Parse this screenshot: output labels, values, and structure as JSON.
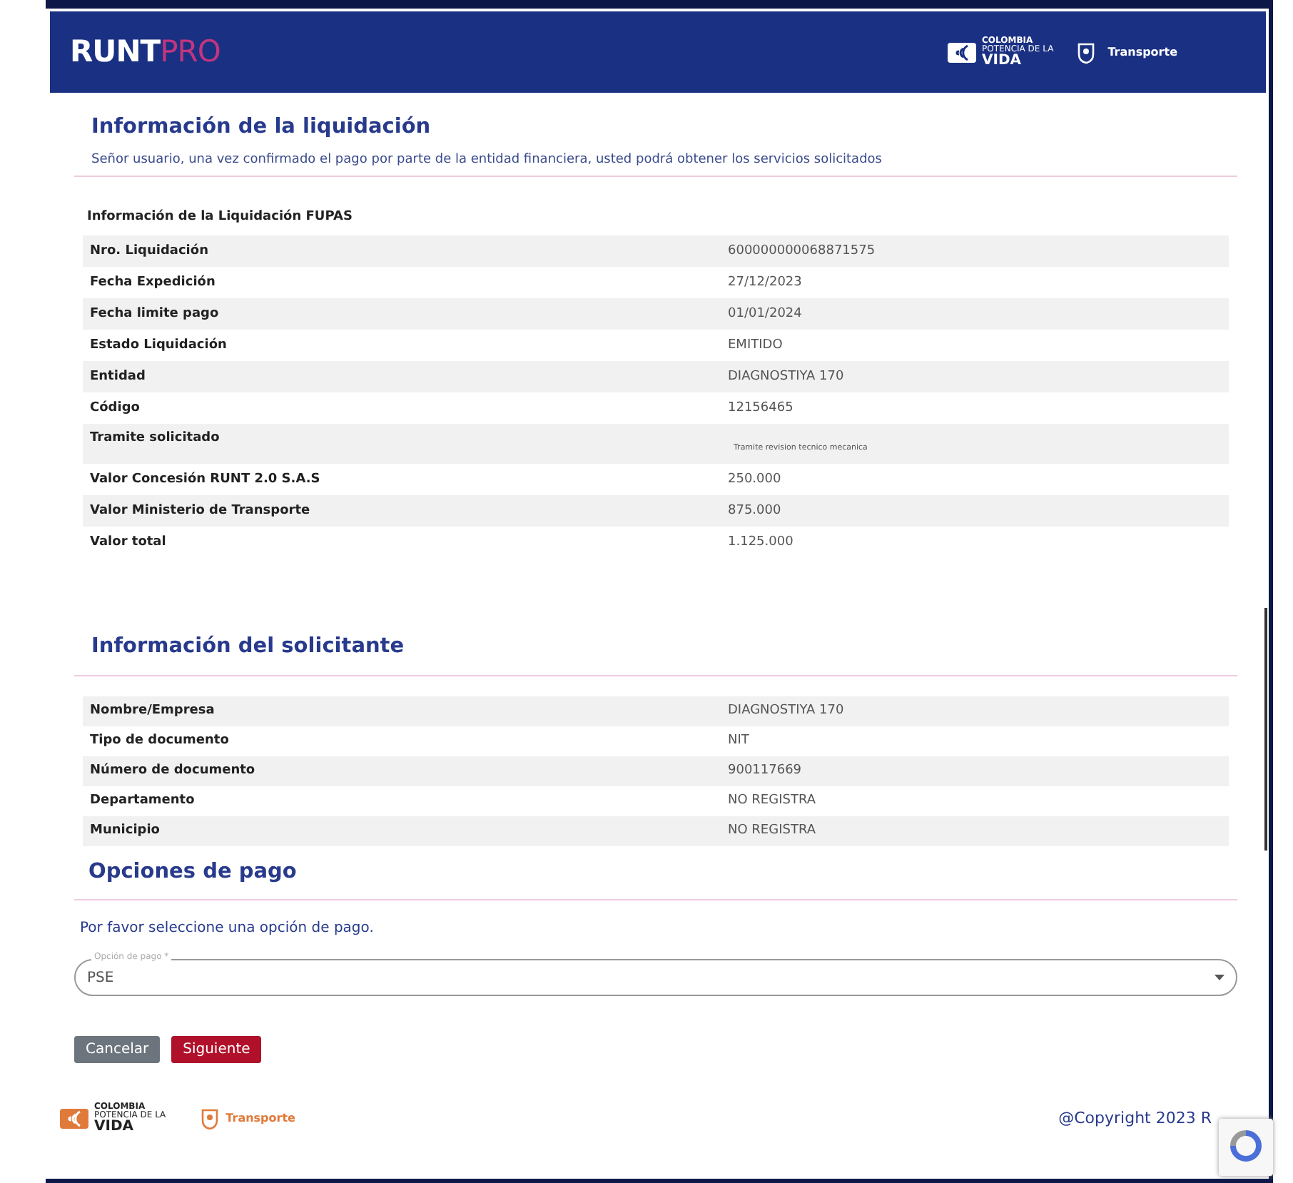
{
  "header": {
    "brand": "RUNT",
    "brand_accent": "PRO",
    "logo_lines": [
      "COLOMBIA",
      "POTENCIA DE LA",
      "VIDA"
    ],
    "ministry": "Transporte"
  },
  "liquidacion": {
    "title": "Información de la liquidación",
    "notice": "Señor usuario, una vez confirmado el pago por parte de la entidad financiera, usted podrá obtener los servicios solicitados",
    "table_title": "Información de la Liquidación FUPAS",
    "rows": [
      {
        "label": "Nro. Liquidación",
        "value": "600000000068871575"
      },
      {
        "label": "Fecha Expedición",
        "value": "27/12/2023"
      },
      {
        "label": "Fecha limite pago",
        "value": "01/01/2024"
      },
      {
        "label": "Estado Liquidación",
        "value": "EMITIDO"
      },
      {
        "label": "Entidad",
        "value": "DIAGNOSTIYA 170"
      },
      {
        "label": "Código",
        "value": "12156465"
      },
      {
        "label": "Tramite solicitado",
        "value": "Tramite revision tecnico mecanica",
        "kind": "small"
      },
      {
        "label": "Valor Concesión RUNT 2.0 S.A.S",
        "value": "250.000"
      },
      {
        "label": "Valor Ministerio de Transporte",
        "value": "875.000"
      },
      {
        "label": "Valor total",
        "value": "1.125.000"
      }
    ]
  },
  "solicitante": {
    "title": "Información del solicitante",
    "rows": [
      {
        "label": "Nombre/Empresa",
        "value": "DIAGNOSTIYA 170"
      },
      {
        "label": "Tipo de documento",
        "value": "NIT"
      },
      {
        "label": "Número de documento",
        "value": "900117669"
      },
      {
        "label": "Departamento",
        "value": "NO REGISTRA"
      },
      {
        "label": "Municipio",
        "value": "NO REGISTRA"
      }
    ]
  },
  "pago": {
    "title": "Opciones de pago",
    "prompt": "Por favor seleccione una opción de pago.",
    "field_label": "Opción de pago *",
    "value": "PSE",
    "buttons": [
      {
        "label": "Cancelar",
        "kind": "secondary"
      },
      {
        "label": "Siguiente",
        "kind": "primary"
      }
    ]
  },
  "footer": {
    "logo_lines": [
      "COLOMBIA",
      "POTENCIA DE LA",
      "VIDA"
    ],
    "ministry": "Transporte",
    "copyright": "@Copyright 2023 R"
  }
}
